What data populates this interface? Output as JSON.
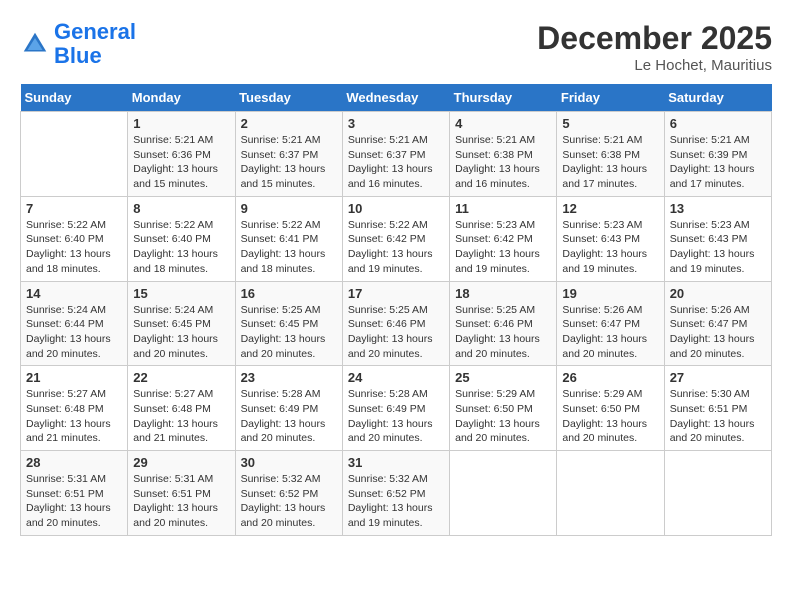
{
  "logo": {
    "line1": "General",
    "line2": "Blue"
  },
  "title": "December 2025",
  "location": "Le Hochet, Mauritius",
  "days_of_week": [
    "Sunday",
    "Monday",
    "Tuesday",
    "Wednesday",
    "Thursday",
    "Friday",
    "Saturday"
  ],
  "weeks": [
    [
      {
        "day": "",
        "info": ""
      },
      {
        "day": "1",
        "info": "Sunrise: 5:21 AM\nSunset: 6:36 PM\nDaylight: 13 hours\nand 15 minutes."
      },
      {
        "day": "2",
        "info": "Sunrise: 5:21 AM\nSunset: 6:37 PM\nDaylight: 13 hours\nand 15 minutes."
      },
      {
        "day": "3",
        "info": "Sunrise: 5:21 AM\nSunset: 6:37 PM\nDaylight: 13 hours\nand 16 minutes."
      },
      {
        "day": "4",
        "info": "Sunrise: 5:21 AM\nSunset: 6:38 PM\nDaylight: 13 hours\nand 16 minutes."
      },
      {
        "day": "5",
        "info": "Sunrise: 5:21 AM\nSunset: 6:38 PM\nDaylight: 13 hours\nand 17 minutes."
      },
      {
        "day": "6",
        "info": "Sunrise: 5:21 AM\nSunset: 6:39 PM\nDaylight: 13 hours\nand 17 minutes."
      }
    ],
    [
      {
        "day": "7",
        "info": "Sunrise: 5:22 AM\nSunset: 6:40 PM\nDaylight: 13 hours\nand 18 minutes."
      },
      {
        "day": "8",
        "info": "Sunrise: 5:22 AM\nSunset: 6:40 PM\nDaylight: 13 hours\nand 18 minutes."
      },
      {
        "day": "9",
        "info": "Sunrise: 5:22 AM\nSunset: 6:41 PM\nDaylight: 13 hours\nand 18 minutes."
      },
      {
        "day": "10",
        "info": "Sunrise: 5:22 AM\nSunset: 6:42 PM\nDaylight: 13 hours\nand 19 minutes."
      },
      {
        "day": "11",
        "info": "Sunrise: 5:23 AM\nSunset: 6:42 PM\nDaylight: 13 hours\nand 19 minutes."
      },
      {
        "day": "12",
        "info": "Sunrise: 5:23 AM\nSunset: 6:43 PM\nDaylight: 13 hours\nand 19 minutes."
      },
      {
        "day": "13",
        "info": "Sunrise: 5:23 AM\nSunset: 6:43 PM\nDaylight: 13 hours\nand 19 minutes."
      }
    ],
    [
      {
        "day": "14",
        "info": "Sunrise: 5:24 AM\nSunset: 6:44 PM\nDaylight: 13 hours\nand 20 minutes."
      },
      {
        "day": "15",
        "info": "Sunrise: 5:24 AM\nSunset: 6:45 PM\nDaylight: 13 hours\nand 20 minutes."
      },
      {
        "day": "16",
        "info": "Sunrise: 5:25 AM\nSunset: 6:45 PM\nDaylight: 13 hours\nand 20 minutes."
      },
      {
        "day": "17",
        "info": "Sunrise: 5:25 AM\nSunset: 6:46 PM\nDaylight: 13 hours\nand 20 minutes."
      },
      {
        "day": "18",
        "info": "Sunrise: 5:25 AM\nSunset: 6:46 PM\nDaylight: 13 hours\nand 20 minutes."
      },
      {
        "day": "19",
        "info": "Sunrise: 5:26 AM\nSunset: 6:47 PM\nDaylight: 13 hours\nand 20 minutes."
      },
      {
        "day": "20",
        "info": "Sunrise: 5:26 AM\nSunset: 6:47 PM\nDaylight: 13 hours\nand 20 minutes."
      }
    ],
    [
      {
        "day": "21",
        "info": "Sunrise: 5:27 AM\nSunset: 6:48 PM\nDaylight: 13 hours\nand 21 minutes."
      },
      {
        "day": "22",
        "info": "Sunrise: 5:27 AM\nSunset: 6:48 PM\nDaylight: 13 hours\nand 21 minutes."
      },
      {
        "day": "23",
        "info": "Sunrise: 5:28 AM\nSunset: 6:49 PM\nDaylight: 13 hours\nand 20 minutes."
      },
      {
        "day": "24",
        "info": "Sunrise: 5:28 AM\nSunset: 6:49 PM\nDaylight: 13 hours\nand 20 minutes."
      },
      {
        "day": "25",
        "info": "Sunrise: 5:29 AM\nSunset: 6:50 PM\nDaylight: 13 hours\nand 20 minutes."
      },
      {
        "day": "26",
        "info": "Sunrise: 5:29 AM\nSunset: 6:50 PM\nDaylight: 13 hours\nand 20 minutes."
      },
      {
        "day": "27",
        "info": "Sunrise: 5:30 AM\nSunset: 6:51 PM\nDaylight: 13 hours\nand 20 minutes."
      }
    ],
    [
      {
        "day": "28",
        "info": "Sunrise: 5:31 AM\nSunset: 6:51 PM\nDaylight: 13 hours\nand 20 minutes."
      },
      {
        "day": "29",
        "info": "Sunrise: 5:31 AM\nSunset: 6:51 PM\nDaylight: 13 hours\nand 20 minutes."
      },
      {
        "day": "30",
        "info": "Sunrise: 5:32 AM\nSunset: 6:52 PM\nDaylight: 13 hours\nand 20 minutes."
      },
      {
        "day": "31",
        "info": "Sunrise: 5:32 AM\nSunset: 6:52 PM\nDaylight: 13 hours\nand 19 minutes."
      },
      {
        "day": "",
        "info": ""
      },
      {
        "day": "",
        "info": ""
      },
      {
        "day": "",
        "info": ""
      }
    ]
  ]
}
